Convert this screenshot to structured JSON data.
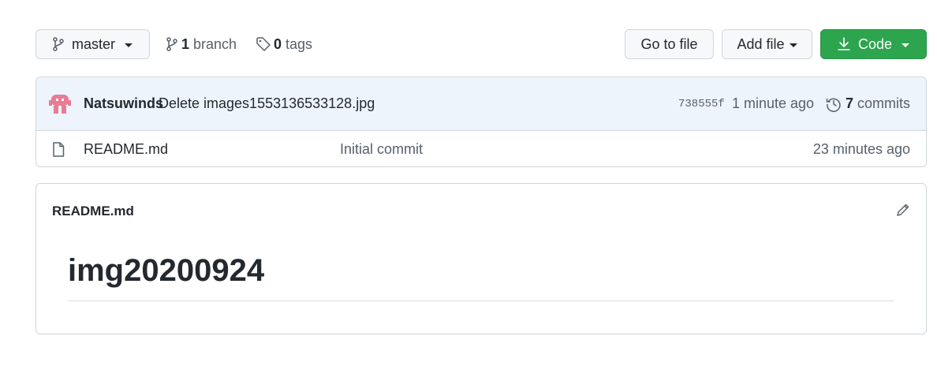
{
  "toolbar": {
    "branch_selector": {
      "label": "master",
      "icon": "git-branch-icon"
    },
    "branches": {
      "count": "1",
      "label": "branch"
    },
    "tags": {
      "count": "0",
      "label": "tags"
    },
    "go_to_file": "Go to file",
    "add_file": "Add file",
    "code": "Code"
  },
  "latest_commit": {
    "author": "Natsuwinds",
    "message": "Delete images1553136533128.jpg",
    "sha": "738555f",
    "time": "1 minute ago",
    "commits_count": "7",
    "commits_label": "commits"
  },
  "files": [
    {
      "name": "README.md",
      "message": "Initial commit",
      "time": "23 minutes ago",
      "icon": "file-icon"
    }
  ],
  "readme": {
    "title": "README.md",
    "heading": "img20200924"
  },
  "colors": {
    "code_button": "#2da44e",
    "commit_bar": "#eef4fb",
    "avatar": "#e97c94"
  }
}
